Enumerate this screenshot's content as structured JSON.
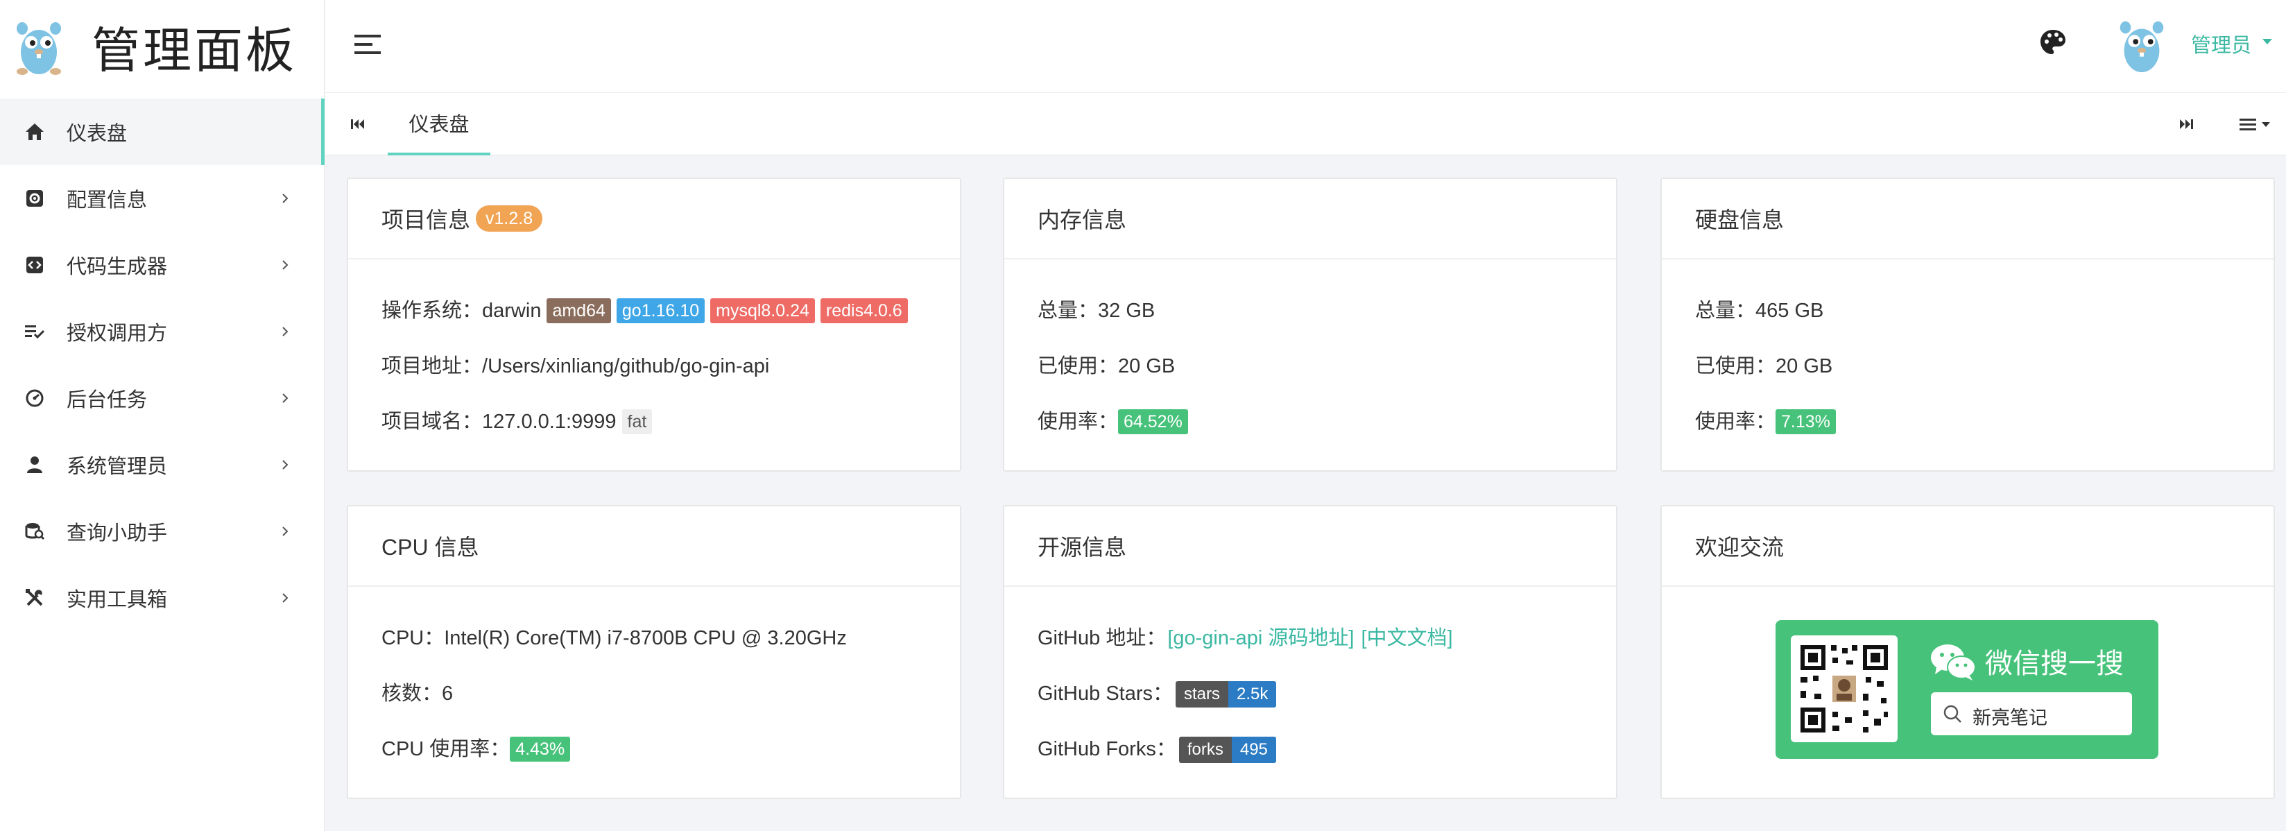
{
  "brand": {
    "title": "管理面板"
  },
  "sidebar": {
    "items": [
      {
        "label": "仪表盘",
        "icon": "home-icon",
        "active": true,
        "has_children": false
      },
      {
        "label": "配置信息",
        "icon": "gear-icon",
        "has_children": true
      },
      {
        "label": "代码生成器",
        "icon": "code-icon",
        "has_children": true
      },
      {
        "label": "授权调用方",
        "icon": "list-check-icon",
        "has_children": true
      },
      {
        "label": "后台任务",
        "icon": "dashboard-gauge-icon",
        "has_children": true
      },
      {
        "label": "系统管理员",
        "icon": "user-icon",
        "has_children": true
      },
      {
        "label": "查询小助手",
        "icon": "database-search-icon",
        "has_children": true
      },
      {
        "label": "实用工具箱",
        "icon": "tools-icon",
        "has_children": true
      }
    ]
  },
  "header": {
    "user_name": "管理员"
  },
  "tabs": [
    {
      "label": "仪表盘",
      "active": true
    }
  ],
  "cards": {
    "project": {
      "title": "项目信息",
      "version": "v1.2.8",
      "os_key": "操作系统：",
      "os_value": "darwin",
      "os_badges": [
        "amd64",
        "go1.16.10",
        "mysql8.0.24",
        "redis4.0.6"
      ],
      "path_key": "项目地址：",
      "path_value": "/Users/xinliang/github/go-gin-api",
      "domain_key": "项目域名：",
      "domain_value": "127.0.0.1:9999",
      "domain_badge": "fat"
    },
    "memory": {
      "title": "内存信息",
      "total_key": "总量：",
      "total_value": "32 GB",
      "used_key": "已使用：",
      "used_value": "20 GB",
      "rate_key": "使用率：",
      "rate_value": "64.52%"
    },
    "disk": {
      "title": "硬盘信息",
      "total_key": "总量：",
      "total_value": "465 GB",
      "used_key": "已使用：",
      "used_value": "20 GB",
      "rate_key": "使用率：",
      "rate_value": "7.13%"
    },
    "cpu": {
      "title": "CPU 信息",
      "model_key": "CPU：",
      "model_value": "Intel(R) Core(TM) i7-8700B CPU @ 3.20GHz",
      "cores_key": "核数：",
      "cores_value": "6",
      "rate_key": "CPU 使用率：",
      "rate_value": "4.43%"
    },
    "opensource": {
      "title": "开源信息",
      "github_key": "GitHub 地址：",
      "github_link1": "[go-gin-api 源码地址]",
      "github_link2": "[中文文档]",
      "stars_key": "GitHub Stars：",
      "stars_label": "stars",
      "stars_value": "2.5k",
      "forks_key": "GitHub Forks：",
      "forks_label": "forks",
      "forks_value": "495"
    },
    "welcome": {
      "title": "欢迎交流",
      "wechat_title": "微信搜一搜",
      "search_text": "新亮笔记"
    }
  },
  "colors": {
    "accent": "#5fd3c0",
    "link": "#3bb8a2",
    "wechat_green": "#46c27a",
    "version_orange": "#f0a454"
  }
}
